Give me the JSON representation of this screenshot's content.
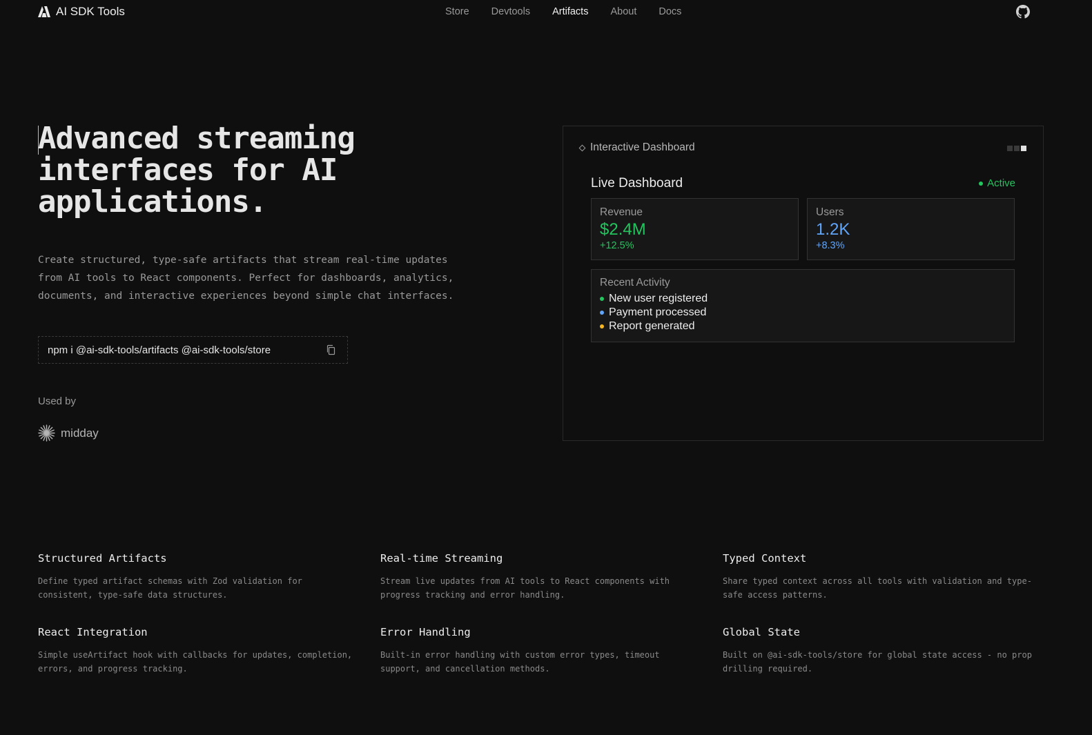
{
  "header": {
    "brand": "AI SDK Tools",
    "nav": [
      {
        "label": "Store",
        "active": false
      },
      {
        "label": "Devtools",
        "active": false
      },
      {
        "label": "Artifacts",
        "active": true
      },
      {
        "label": "About",
        "active": false
      },
      {
        "label": "Docs",
        "active": false
      }
    ],
    "github_icon": "github-icon"
  },
  "hero": {
    "title_lines": [
      "Advanced streaming",
      "interfaces for AI",
      "applications."
    ],
    "description_lines": [
      "Create structured, type-safe artifacts that stream real-time updates",
      "from AI tools to React components. Perfect for dashboards, analytics,",
      "documents, and interactive experiences beyond simple chat interfaces."
    ],
    "install_command": "npm i @ai-sdk-tools/artifacts @ai-sdk-tools/store",
    "used_by_label": "Used by",
    "customer": "midday"
  },
  "dashboard_panel": {
    "title": "Interactive Dashboard",
    "dashboard_title": "Live Dashboard",
    "status": "Active",
    "metrics": [
      {
        "label": "Revenue",
        "value": "$2.4M",
        "change": "+12.5%",
        "color": "#22c55e"
      },
      {
        "label": "Users",
        "value": "1.2K",
        "change": "+8.3%",
        "color": "#60a5fa"
      }
    ],
    "activity_title": "Recent Activity",
    "activity": [
      {
        "label": "New user registered",
        "color": "#22c55e"
      },
      {
        "label": "Payment processed",
        "color": "#60a5fa"
      },
      {
        "label": "Report generated",
        "color": "#f5b622"
      }
    ]
  },
  "features": [
    {
      "title": "Structured Artifacts",
      "description": "Define typed artifact schemas with Zod validation for consistent, type-safe data structures."
    },
    {
      "title": "Real-time Streaming",
      "description": "Stream live updates from AI tools to React components with progress tracking and error handling."
    },
    {
      "title": "Typed Context",
      "description": "Share typed context across all tools with validation and type-safe access patterns."
    },
    {
      "title": "React Integration",
      "description": "Simple useArtifact hook with callbacks for updates, completion, errors, and progress tracking."
    },
    {
      "title": "Error Handling",
      "description": "Built-in error handling with custom error types, timeout support, and cancellation methods."
    },
    {
      "title": "Global State",
      "description": "Built on @ai-sdk-tools/store for global state access - no prop drilling required."
    }
  ]
}
